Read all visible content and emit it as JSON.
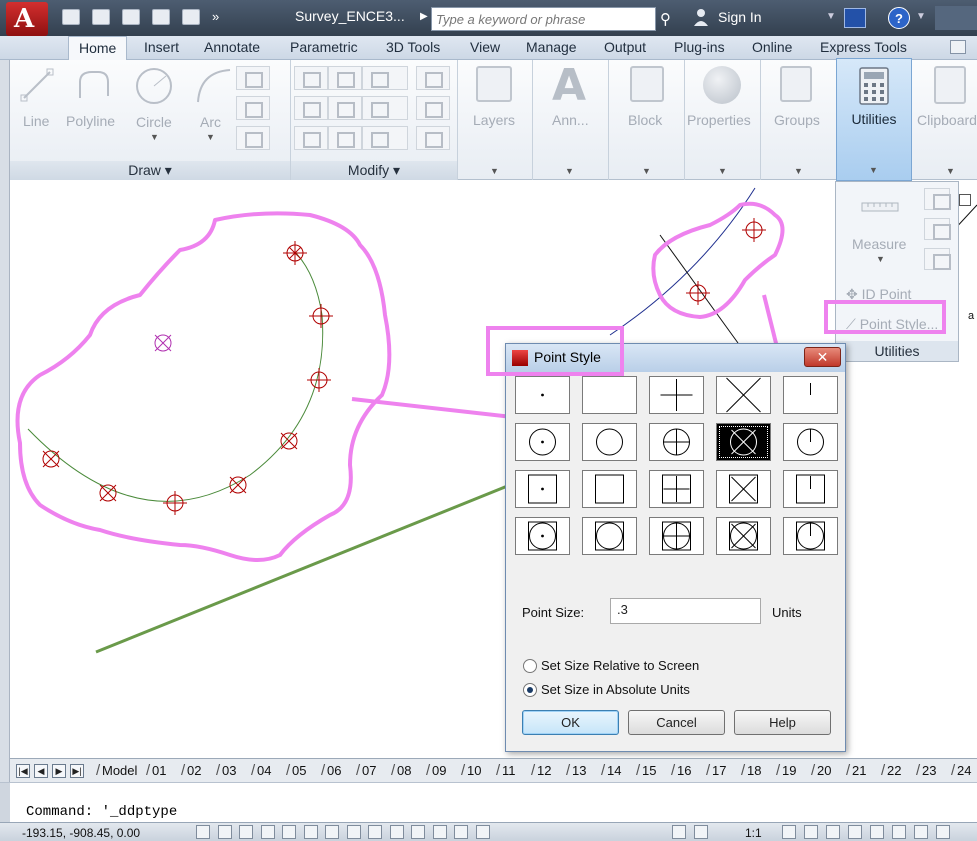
{
  "titlebar": {
    "app_button": "A",
    "document_title": "Survey_ENCE3...",
    "search_placeholder": "Type a keyword or phrase",
    "sign_in": "Sign In",
    "help": "?"
  },
  "ribbon_tabs": [
    "Home",
    "Insert",
    "Annotate",
    "Parametric",
    "3D Tools",
    "View",
    "Manage",
    "Output",
    "Plug-ins",
    "Online",
    "Express Tools"
  ],
  "active_tab": "Home",
  "draw_panel": {
    "title": "Draw",
    "buttons": [
      "Line",
      "Polyline",
      "Circle",
      "Arc"
    ]
  },
  "modify_panel": {
    "title": "Modify"
  },
  "big_buttons": [
    "Layers",
    "Ann...",
    "Block",
    "Properties",
    "Groups",
    "Utilities",
    "Clipboard"
  ],
  "utilities_dropdown": {
    "measure": "Measure",
    "id_point": "ID Point",
    "point_style": "Point Style...",
    "title": "Utilities"
  },
  "canvas": {
    "annotation_text": "a"
  },
  "dialog": {
    "title": "Point Style",
    "close": "✕",
    "selected_index": 8,
    "point_size_label": "Point Size:",
    "point_size_value": ".3",
    "units_label": "Units",
    "radio_relative": "Set Size Relative to Screen",
    "radio_absolute": "Set Size in Absolute Units",
    "selected_radio": "absolute",
    "ok": "OK",
    "cancel": "Cancel",
    "help": "Help"
  },
  "layout_tabs": [
    "Model",
    "01",
    "02",
    "03",
    "04",
    "05",
    "06",
    "07",
    "08",
    "09",
    "10",
    "11",
    "12",
    "13",
    "14",
    "15",
    "16",
    "17",
    "18",
    "19",
    "20",
    "21",
    "22",
    "23",
    "24"
  ],
  "command_line": "Command: '_ddptype",
  "status": {
    "coordinates": "-193.15, -908.45, 0.00",
    "scale": "1:1"
  },
  "colors": {
    "highlight_pink": "#ee82ee",
    "point_red": "#b00000",
    "arc_green": "#4a8a3a",
    "line_green": "#6a9a4a",
    "blue_line": "#1f2f8f"
  }
}
